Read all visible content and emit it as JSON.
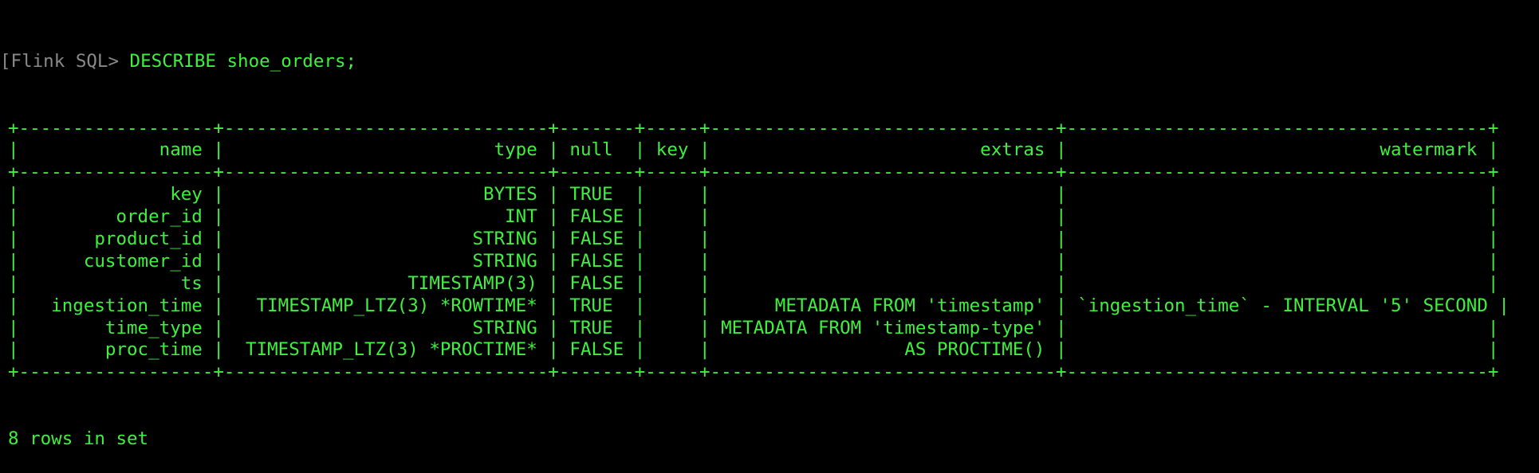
{
  "prompt": {
    "bracket": "[",
    "label": "Flink SQL>",
    "command": " DESCRIBE shoe_orders;"
  },
  "table": {
    "columns": [
      "name",
      "type",
      "null",
      "key",
      "extras",
      "watermark"
    ],
    "rows": [
      [
        "key",
        "BYTES",
        "TRUE",
        "",
        "",
        ""
      ],
      [
        "order_id",
        "INT",
        "FALSE",
        "",
        "",
        ""
      ],
      [
        "product_id",
        "STRING",
        "FALSE",
        "",
        "",
        ""
      ],
      [
        "customer_id",
        "STRING",
        "FALSE",
        "",
        "",
        ""
      ],
      [
        "ts",
        "TIMESTAMP(3)",
        "FALSE",
        "",
        "",
        ""
      ],
      [
        "ingestion_time",
        "TIMESTAMP_LTZ(3) *ROWTIME*",
        "TRUE",
        "",
        "METADATA FROM 'timestamp'",
        "`ingestion_time` - INTERVAL '5' SECOND"
      ],
      [
        "time_type",
        "STRING",
        "TRUE",
        "",
        "METADATA FROM 'timestamp-type'",
        ""
      ],
      [
        "proc_time",
        "TIMESTAMP_LTZ(3) *PROCTIME*",
        "FALSE",
        "",
        "AS PROCTIME()",
        ""
      ]
    ]
  },
  "footer": "8 rows in set",
  "colors": {
    "text": "#3ff03f",
    "prompt_bracket": "#8a8a8a",
    "background": "#000000"
  }
}
